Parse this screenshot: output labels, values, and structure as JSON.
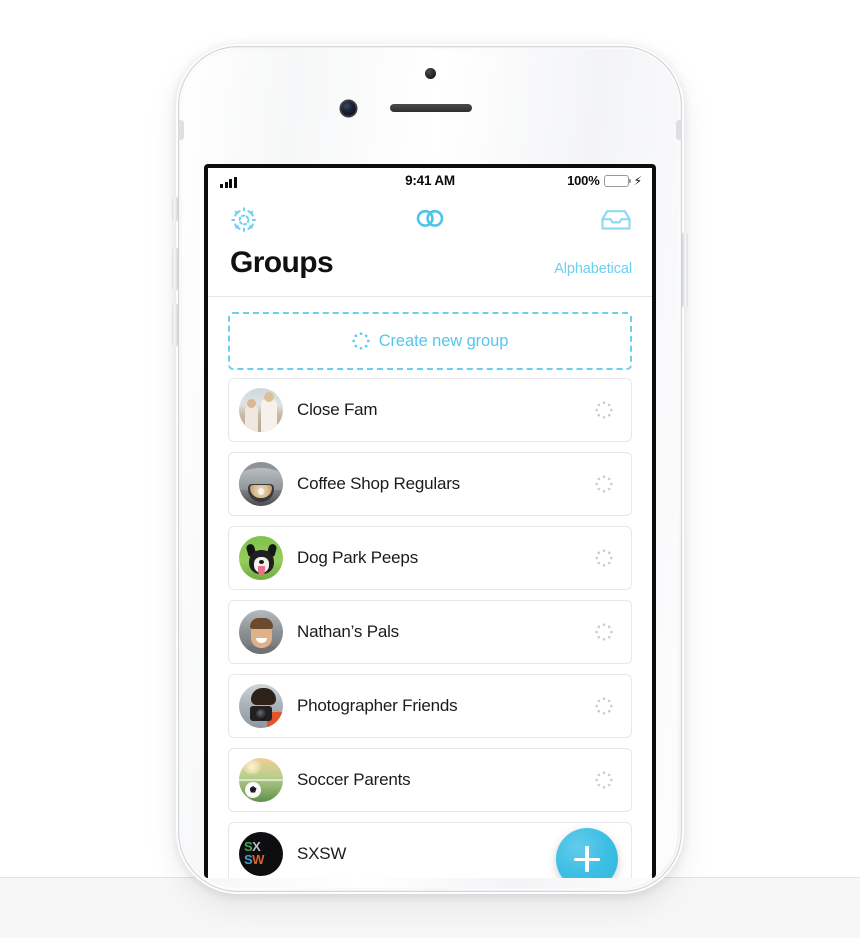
{
  "device": {
    "name": "iphone-white",
    "sensors": [
      "proximity-sensor",
      "front-camera",
      "earpiece-speaker"
    ],
    "buttons": [
      "mute-switch",
      "volume-up",
      "volume-down",
      "power-button"
    ]
  },
  "status_bar": {
    "signal_icon": "cellular-signal-icon",
    "signal_bars": 4,
    "time": "9:41 AM",
    "battery_percent": "100%",
    "battery_icon": "battery-full-icon",
    "charging_icon": "lightning-bolt-icon",
    "battery_color": "#4cd764"
  },
  "nav": {
    "settings_icon": "gear-icon",
    "logo_icon": "two-circles-logo-icon",
    "inbox_icon": "inbox-tray-icon",
    "accent_color": "#6ccff0"
  },
  "header": {
    "title": "Groups",
    "sort_label": "Alphabetical",
    "sort_color": "#6dcff0"
  },
  "create_button": {
    "label": "Create new group",
    "icon": "dotted-circle-icon",
    "border_color": "#6ccff0",
    "text_color": "#55c6ec"
  },
  "groups": [
    {
      "name": "Close Fam",
      "avatar": "family-photo-avatar",
      "action_icon": "dotted-circle-icon"
    },
    {
      "name": "Coffee Shop Regulars",
      "avatar": "latte-photo-avatar",
      "action_icon": "dotted-circle-icon"
    },
    {
      "name": "Dog Park Peeps",
      "avatar": "dog-photo-avatar",
      "action_icon": "dotted-circle-icon"
    },
    {
      "name": "Nathan’s Pals",
      "avatar": "man-portrait-avatar",
      "action_icon": "dotted-circle-icon"
    },
    {
      "name": "Photographer Friends",
      "avatar": "photographer-photo-avatar",
      "action_icon": "dotted-circle-icon"
    },
    {
      "name": "Soccer Parents",
      "avatar": "soccer-ball-photo-avatar",
      "action_icon": "dotted-circle-icon"
    },
    {
      "name": "SXSW",
      "avatar": "sxsw-logo-avatar",
      "action_icon": "dotted-circle-icon"
    }
  ],
  "fab": {
    "icon": "plus-icon",
    "color": "#3dbfe3"
  },
  "sxsw_logo": {
    "line1_left": "S",
    "line1_right": "X",
    "line2_left": "S",
    "line2_right": "W"
  }
}
